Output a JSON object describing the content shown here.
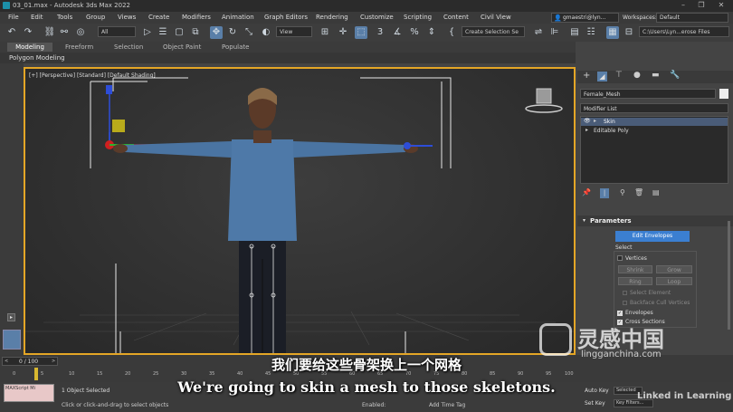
{
  "window": {
    "title": "03_01.max - Autodesk 3ds Max 2022",
    "buttons": [
      "–",
      "❐",
      "✕"
    ]
  },
  "menu": {
    "items": [
      "File",
      "Edit",
      "Tools",
      "Group",
      "Views",
      "Create",
      "Modifiers",
      "Animation",
      "Graph Editors",
      "Rendering",
      "Customize",
      "Scripting",
      "Content",
      "Civil View"
    ],
    "user": "gmaestri@lyn...",
    "workspaces_label": "Workspaces:",
    "workspaces_value": "Default"
  },
  "toolbar": {
    "selection_filter": "All",
    "reference_coord": "View",
    "create_selection_set": "Create Selection Se",
    "project_path": "C:\\Users\\Lyn...erose Files"
  },
  "ribbon": {
    "tabs": [
      "Modeling",
      "Freeform",
      "Selection",
      "Object Paint",
      "Populate"
    ],
    "subtab": "Polygon Modeling"
  },
  "viewport": {
    "label": "[+] [Perspective] [Standard] [Default Shading]"
  },
  "command_panel": {
    "object_name": "Female_Mesh",
    "modifier_list": "Modifier List",
    "stack": [
      "Skin",
      "Editable Poly"
    ],
    "rollout_title": "Parameters",
    "edit_envelopes": "Edit Envelopes",
    "select_label": "Select",
    "vertices": "Vertices",
    "shrink": "Shrink",
    "grow": "Grow",
    "ring": "Ring",
    "loop": "Loop",
    "select_element": "Select Element",
    "backface_cull": "Backface Cull Vertices",
    "envelopes": "Envelopes",
    "cross_sections": "Cross Sections"
  },
  "timeline": {
    "frame": "0 / 100",
    "ticks": [
      "0",
      "5",
      "10",
      "15",
      "20",
      "25",
      "30",
      "35",
      "40",
      "45",
      "50",
      "55",
      "60",
      "65",
      "70",
      "75",
      "80",
      "85",
      "90",
      "95",
      "100"
    ]
  },
  "status": {
    "maxscript": "MAXScript Mi",
    "selected": "1 Object Selected",
    "prompt": "Click or click-and-drag to select objects",
    "enabled": "Enabled:",
    "add_time_tag": "Add Time Tag",
    "auto_key": "Auto Key",
    "set_key": "Set Key",
    "selected_dd": "Selected",
    "key_filters": "Key Filters..."
  },
  "subtitles": {
    "chinese": "我们要给这些骨架换上一个网格",
    "english": "We're going to skin a mesh to those skeletons."
  },
  "watermarks": {
    "lingganchina_cn": "灵感中国",
    "lingganchina_url": "lingganchina.com",
    "linkedin": "Linked in Learning"
  }
}
